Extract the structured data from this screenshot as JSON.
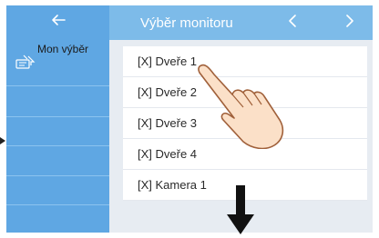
{
  "header": {
    "title": "Výběr monitoru",
    "back_icon": "arrow-left-icon",
    "prev_icon": "chevron-left-icon",
    "next_icon": "chevron-right-icon"
  },
  "sidebar": {
    "items": [
      {
        "label": "Mon výběr",
        "icon": "monitor-select-icon",
        "selected": true
      }
    ]
  },
  "list": {
    "items": [
      {
        "label": "[X] Dveře 1"
      },
      {
        "label": "[X] Dveře 2"
      },
      {
        "label": "[X] Dveře 3"
      },
      {
        "label": "[X] Dveře 4"
      },
      {
        "label": "[X] Kamera 1"
      }
    ]
  },
  "overlay": {
    "hand_icon": "pointing-hand-icon",
    "down_arrow_icon": "arrow-down-icon"
  },
  "colors": {
    "header_bg": "#7dbbe9",
    "sidebar_bg": "#5fa7e3",
    "content_bg": "#e7ecf2",
    "list_bg": "#ffffff"
  }
}
